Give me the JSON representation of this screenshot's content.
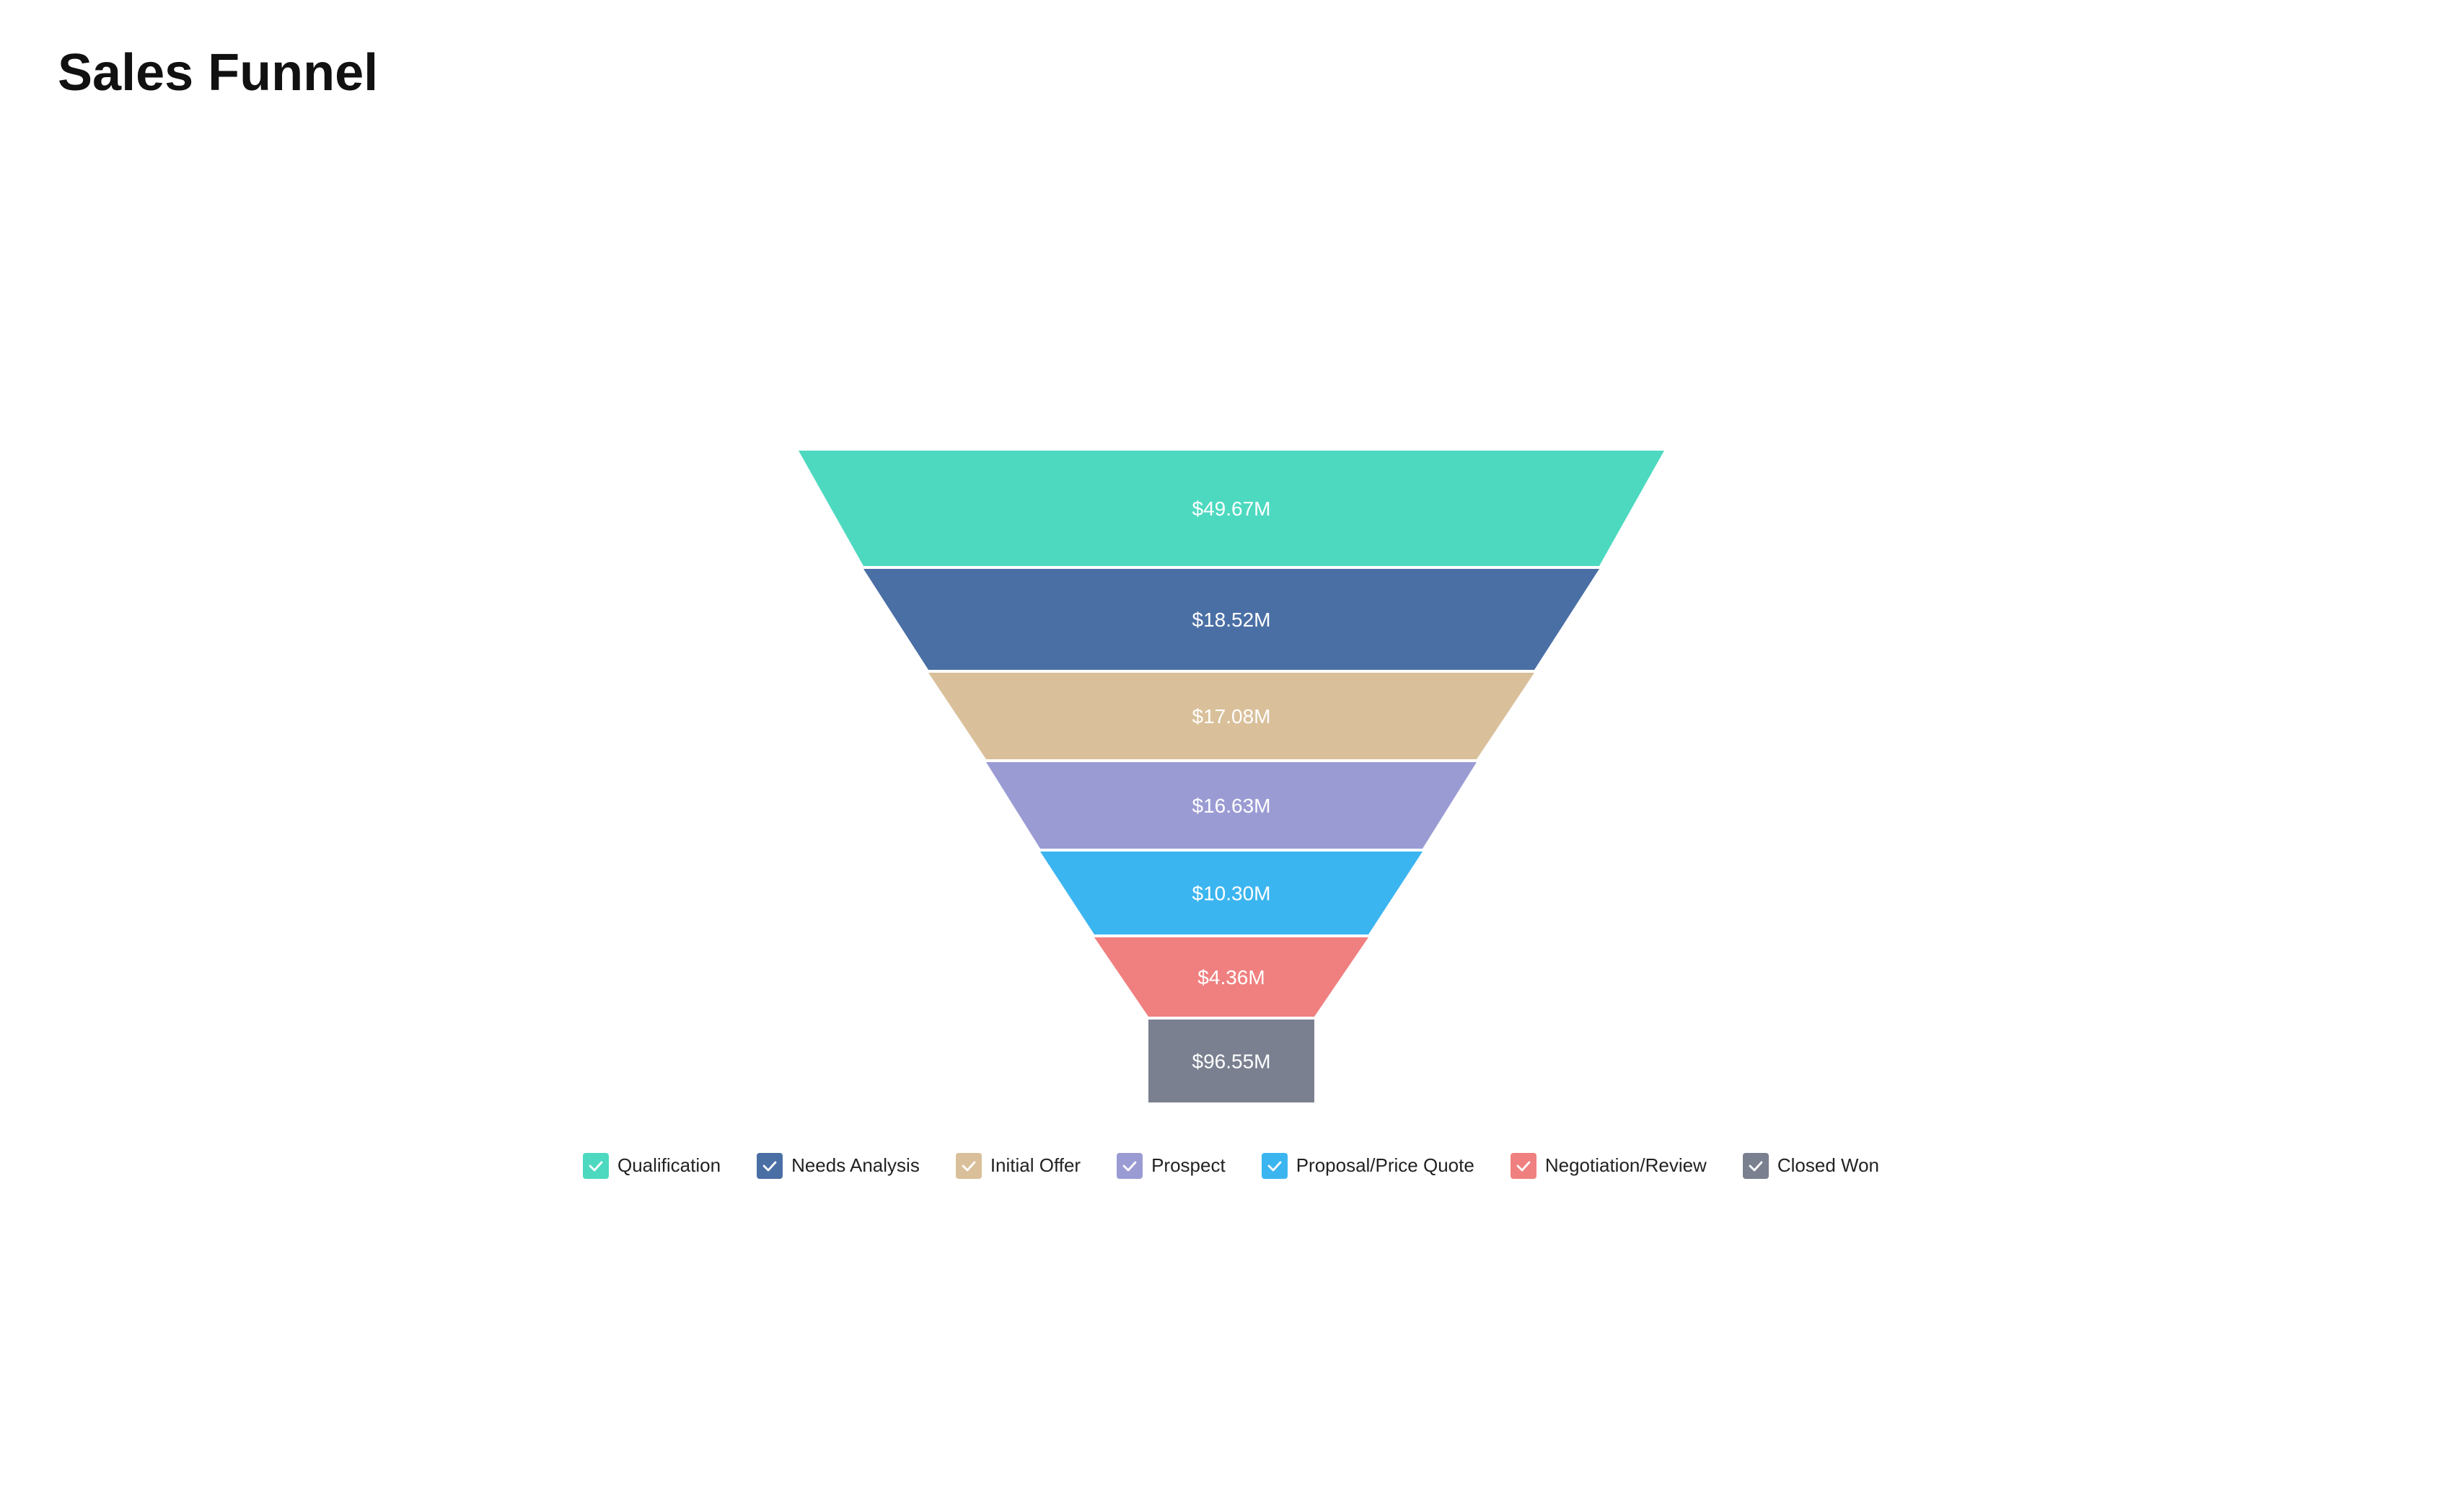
{
  "title": "Sales Funnel",
  "funnel": {
    "segments": [
      {
        "label": "Qualification",
        "value": "$49.67M",
        "color": "#4DD9C0",
        "topW": 1200,
        "botW": 1020,
        "height": 160
      },
      {
        "label": "Needs Analysis",
        "value": "$18.52M",
        "color": "#4A6FA5",
        "topW": 1020,
        "botW": 840,
        "height": 140
      },
      {
        "label": "Initial Offer",
        "value": "$17.08M",
        "color": "#D9C09A",
        "topW": 840,
        "botW": 680,
        "height": 120
      },
      {
        "label": "Prospect",
        "value": "$16.63M",
        "color": "#9B9BD4",
        "topW": 680,
        "botW": 530,
        "height": 120
      },
      {
        "label": "Proposal/Price Quote",
        "value": "$10.30M",
        "color": "#3BB5F0",
        "topW": 530,
        "botW": 380,
        "height": 115
      },
      {
        "label": "Negotiation/Review",
        "value": "$4.36M",
        "color": "#F08080",
        "topW": 380,
        "botW": 230,
        "height": 110
      },
      {
        "label": "Closed Won",
        "value": "$96.55M",
        "color": "#7A8090",
        "topW": 230,
        "botW": 230,
        "height": 115
      }
    ]
  },
  "legend": {
    "items": [
      {
        "label": "Qualification",
        "color": "#4DD9C0"
      },
      {
        "label": "Needs Analysis",
        "color": "#4A6FA5"
      },
      {
        "label": "Initial Offer",
        "color": "#D9C09A"
      },
      {
        "label": "Prospect",
        "color": "#9B9BD4"
      },
      {
        "label": "Proposal/Price Quote",
        "color": "#3BB5F0"
      },
      {
        "label": "Negotiation/Review",
        "color": "#F08080"
      },
      {
        "label": "Closed Won",
        "color": "#7A8090"
      }
    ]
  }
}
